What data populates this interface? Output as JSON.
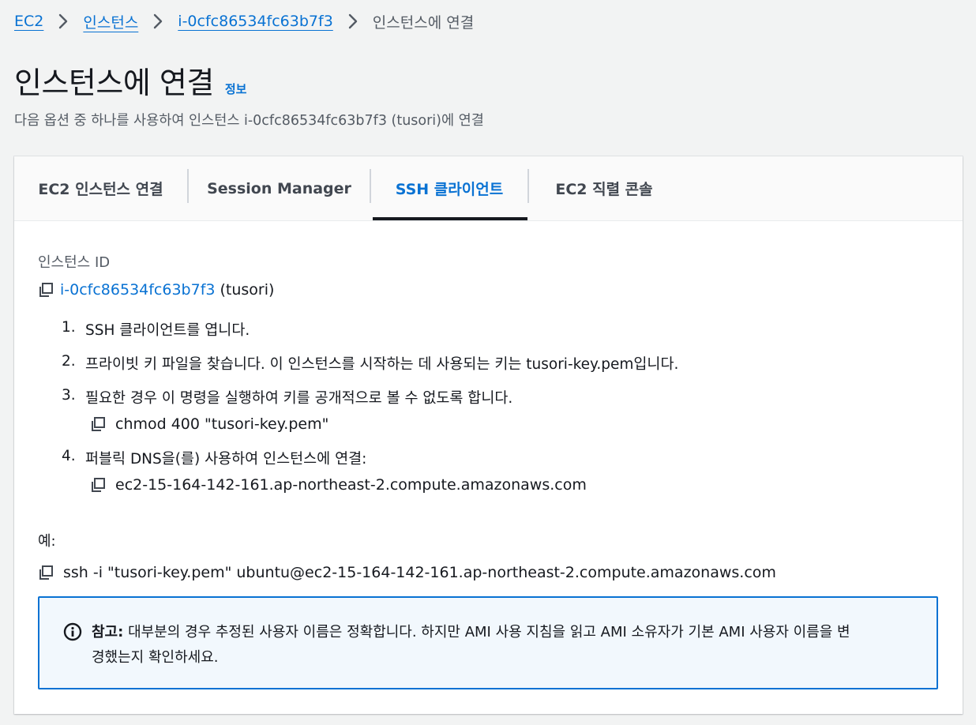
{
  "breadcrumb": {
    "items": [
      "EC2",
      "인스턴스",
      "i-0cfc86534fc63b7f3"
    ],
    "current": "인스턴스에 연결"
  },
  "header": {
    "title": "인스턴스에 연결",
    "info": "정보",
    "description": "다음 옵션 중 하나를 사용하여 인스턴스 i-0cfc86534fc63b7f3 (tusori)에 연결"
  },
  "tabs": [
    {
      "label": "EC2 인스턴스 연결",
      "active": false
    },
    {
      "label": "Session Manager",
      "active": false
    },
    {
      "label": "SSH 클라이언트",
      "active": true
    },
    {
      "label": "EC2 직렬 콘솔",
      "active": false
    }
  ],
  "instance": {
    "label": "인스턴스 ID",
    "id": "i-0cfc86534fc63b7f3",
    "name": "(tusori)"
  },
  "steps": [
    {
      "num": "1.",
      "text": "SSH 클라이언트를 엽니다."
    },
    {
      "num": "2.",
      "text": "프라이빗 키 파일을 찾습니다. 이 인스턴스를 시작하는 데 사용되는 키는 tusori-key.pem입니다."
    },
    {
      "num": "3.",
      "text": "필요한 경우 이 명령을 실행하여 키를 공개적으로 볼 수 없도록 합니다.",
      "command": "chmod 400 \"tusori-key.pem\""
    },
    {
      "num": "4.",
      "text": "퍼블릭 DNS을(를) 사용하여 인스턴스에 연결:",
      "command": "ec2-15-164-142-161.ap-northeast-2.compute.amazonaws.com"
    }
  ],
  "example": {
    "label": "예:",
    "command": "ssh -i \"tusori-key.pem\" ubuntu@ec2-15-164-142-161.ap-northeast-2.compute.amazonaws.com"
  },
  "note": {
    "title": "참고:",
    "text": "대부분의 경우 추정된 사용자 이름은 정확합니다. 하지만 AMI 사용 지침을 읽고 AMI 소유자가 기본 AMI 사용자 이름을 변경했는지 확인하세요.",
    "line1": "대부분의 경우 추정된 사용자 이름은 정확합니다. 하지만 AMI 사용 지침을 읽고 AMI 소유자가 기본 AMI 사용자 이름을 변",
    "line2": "경했는지 확인하세요."
  },
  "colors": {
    "link": "#0972d3",
    "text": "#16191f",
    "muted": "#545b64",
    "note_bg": "#f2f8fd",
    "background": "#f2f3f3"
  },
  "icons": [
    "chevron-right-icon",
    "copy-icon",
    "info-icon"
  ]
}
